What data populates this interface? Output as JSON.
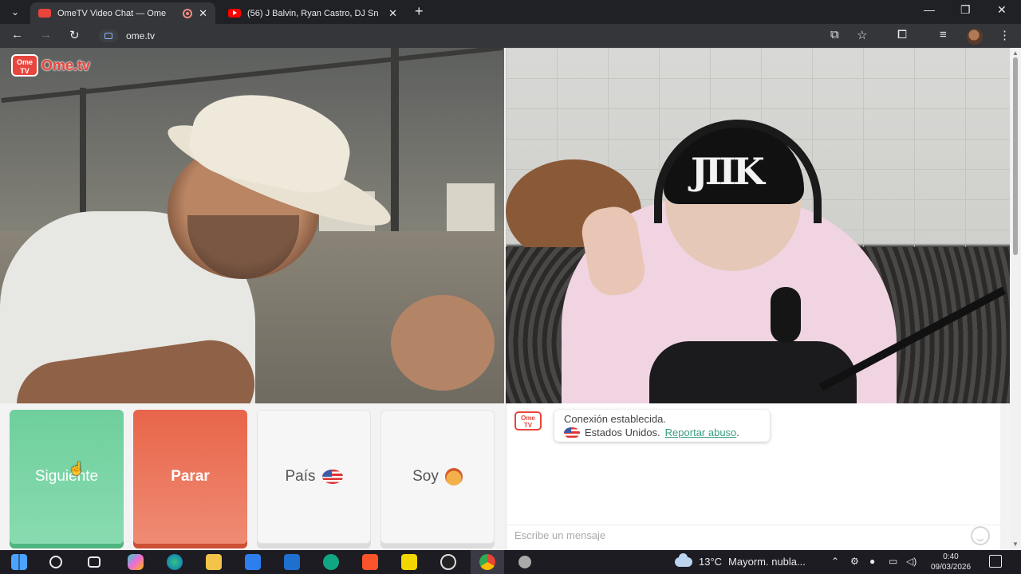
{
  "browser": {
    "tabs": [
      {
        "title": "OmeTV Video Chat — Ome",
        "active": true
      },
      {
        "title": "(56) J Balvin, Ryan Castro, DJ Sn",
        "active": false
      }
    ],
    "new_tab": "+",
    "address": "ome.tv",
    "window_controls": {
      "minimize": "—",
      "restore": "❐",
      "close": "✕"
    },
    "toolbar_icons": [
      "back-icon",
      "forward-icon",
      "reload-icon",
      "cast-icon",
      "star-icon",
      "extensions-icon",
      "media-icon",
      "profile-avatar",
      "menu-icon"
    ]
  },
  "ometv": {
    "logo": {
      "badge": "Ome TV",
      "text": "Ome.tv"
    },
    "buttons": {
      "next": "Siguiente",
      "stop": "Parar",
      "country": "País",
      "gender": "Soy"
    },
    "chat": {
      "logo": "Ome TV",
      "status": "Conexión establecida.",
      "country": "Estados Unidos.",
      "report_link": "Reportar abuso",
      "report_suffix": ".",
      "input_placeholder": "Escribe un mensaje"
    },
    "remote_video_hat_text": "JIIK"
  },
  "taskbar": {
    "weather_temp": "13°C",
    "weather_text": "Mayorm. nubla...",
    "time": "0:40",
    "date": "09/03/2026",
    "apps": [
      "start-icon",
      "search-icon",
      "task-view-icon",
      "copilot-icon",
      "edge-icon",
      "file-explorer-icon",
      "store-icon",
      "outlook-icon",
      "app-icon",
      "brave-icon",
      "sticky-notes-icon",
      "obs-icon",
      "chrome-icon",
      "app2-icon"
    ]
  },
  "colors": {
    "next": "#6fcf9c",
    "stop": "#e8654a",
    "brand": "#e8453c",
    "link": "#3a9f82"
  }
}
